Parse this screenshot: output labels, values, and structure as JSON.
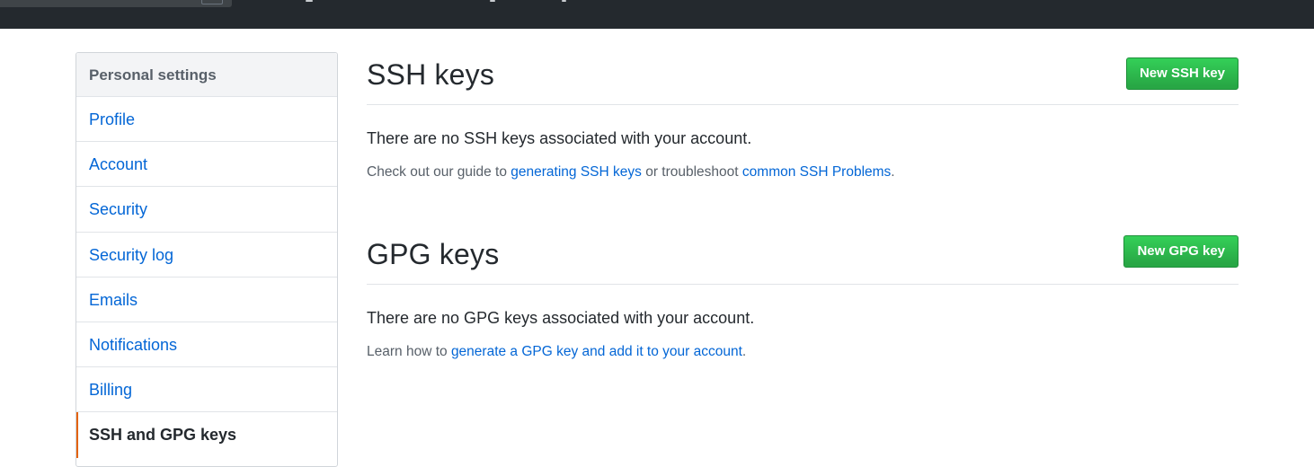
{
  "sidebar": {
    "header": "Personal settings",
    "items": [
      {
        "label": "Profile"
      },
      {
        "label": "Account"
      },
      {
        "label": "Security"
      },
      {
        "label": "Security log"
      },
      {
        "label": "Emails"
      },
      {
        "label": "Notifications"
      },
      {
        "label": "Billing"
      },
      {
        "label": "SSH and GPG keys",
        "selected": true
      }
    ]
  },
  "ssh": {
    "title": "SSH keys",
    "new_button": "New SSH key",
    "blank_text": "There are no SSH keys associated with your account.",
    "note_prefix": "Check out our guide to ",
    "link_guide": "generating SSH keys",
    "note_middle": " or troubleshoot ",
    "link_problems": "common SSH Problems",
    "note_suffix": "."
  },
  "gpg": {
    "title": "GPG keys",
    "new_button": "New GPG key",
    "blank_text": "There are no GPG keys associated with your account.",
    "note_prefix": "Learn how to ",
    "link_generate": "generate a GPG key and add it to your account",
    "note_suffix": "."
  },
  "colors": {
    "header_bg": "#24292e",
    "link": "#0366d6",
    "primary_button": "#28a745",
    "selected_indicator": "#e36209"
  }
}
